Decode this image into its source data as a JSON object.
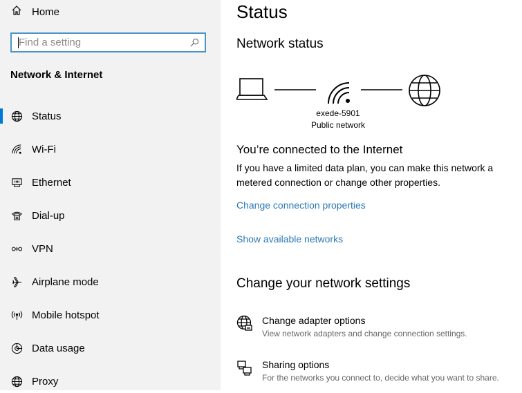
{
  "sidebar": {
    "home_label": "Home",
    "search_placeholder": "Find a setting",
    "section_title": "Network & Internet",
    "items": [
      {
        "label": "Status",
        "icon": "globe-icon",
        "active": true
      },
      {
        "label": "Wi-Fi",
        "icon": "wifi-icon"
      },
      {
        "label": "Ethernet",
        "icon": "ethernet-icon"
      },
      {
        "label": "Dial-up",
        "icon": "dialup-icon"
      },
      {
        "label": "VPN",
        "icon": "vpn-icon"
      },
      {
        "label": "Airplane mode",
        "icon": "airplane-icon"
      },
      {
        "label": "Mobile hotspot",
        "icon": "hotspot-icon"
      },
      {
        "label": "Data usage",
        "icon": "data-usage-icon"
      },
      {
        "label": "Proxy",
        "icon": "globe-icon"
      }
    ]
  },
  "main": {
    "title": "Status",
    "network_status_heading": "Network status",
    "network_name": "exede-5901",
    "network_type": "Public network",
    "connected_heading": "You’re connected to the Internet",
    "connected_text": "If you have a limited data plan, you can make this network a metered connection or change other properties.",
    "link_change_properties": "Change connection properties",
    "link_show_networks": "Show available networks",
    "change_settings_heading": "Change your network settings",
    "options": [
      {
        "title": "Change adapter options",
        "description": "View network adapters and change connection settings.",
        "icon": "adapter-icon"
      },
      {
        "title": "Sharing options",
        "description": "For the networks you connect to, decide what you want to share.",
        "icon": "sharing-icon"
      }
    ]
  },
  "colors": {
    "accent": "#0078d7",
    "link": "#2b79b8",
    "sidebar_bg": "#f2f2f2",
    "search_border": "#4a95c8"
  }
}
